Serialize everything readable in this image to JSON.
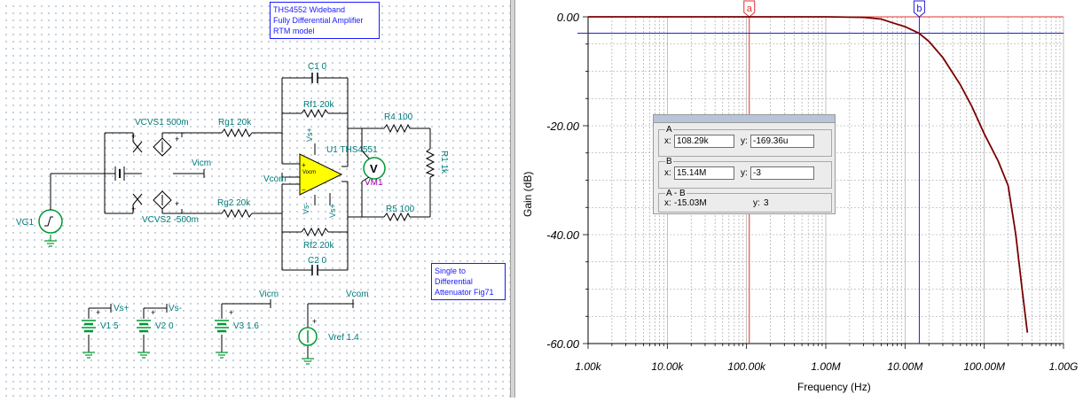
{
  "schematic": {
    "notes": {
      "title": [
        "THS4552 Wideband",
        "Fully Differential Amplifier",
        "RTM model"
      ],
      "config": [
        "Single to",
        "Differential",
        "Attenuator Fig71"
      ]
    },
    "labels": {
      "c1": "C1 0",
      "rf1": "Rf1 20k",
      "rg1": "Rg1 20k",
      "vcvs1": "VCVS1 500m",
      "r4": "R4 100",
      "u1": "U1 THS4551",
      "vicm_mid": "Vicm",
      "vcom_amp": "Vcom",
      "vm1": "VM1",
      "r1": "R1 1k",
      "rg2": "Rg2 20k",
      "vcvs2": "VCVS2 -500m",
      "r5": "R5 100",
      "vg1": "VG1",
      "rf2": "Rf2 20k",
      "c2": "C2 0",
      "vs_plus_top": "Vs+",
      "vs_minus_pin": "Vs-",
      "vs_plus_bottom": "Vs+",
      "vocm": "Vocm",
      "vs_plus_src": "Vs+",
      "vs_minus_src": "Vs-",
      "v1": "V1 5",
      "v2": "V2 0",
      "vicm_src": "Vicm",
      "v3": "V3 1.6",
      "vcom_src": "Vcom",
      "vref": "Vref 1.4",
      "meter_symbol": "V"
    }
  },
  "plot": {
    "ylabel": "Gain (dB)",
    "xlabel": "Frequency (Hz)",
    "y_ticks": [
      "0.00",
      "-20.00",
      "-40.00",
      "-60.00"
    ],
    "x_ticks": [
      "1.00k",
      "10.00k",
      "100.00k",
      "1.00M",
      "10.00M",
      "100.00M",
      "1.00G"
    ],
    "cursor_a_label": "a",
    "cursor_b_label": "b",
    "readout": {
      "a_title": "A",
      "a_x_label": "x:",
      "a_x": "108.29k",
      "a_y_label": "y:",
      "a_y": "-169.36u",
      "b_title": "B",
      "b_x_label": "x:",
      "b_x": "15.14M",
      "b_y_label": "y:",
      "b_y": "-3",
      "ab_title": "A - B",
      "ab_x_label": "x:",
      "ab_x": "-15.03M",
      "ab_y_label": "y:",
      "ab_y": "3"
    }
  },
  "chart_data": {
    "type": "line",
    "title": "",
    "xlabel": "Frequency (Hz)",
    "ylabel": "Gain (dB)",
    "x_scale": "log",
    "xlim": [
      1000,
      1000000000
    ],
    "ylim": [
      -60,
      0
    ],
    "grid": true,
    "x": [
      1000,
      10000,
      100000,
      1000000,
      3000000,
      5000000,
      7000000,
      10000000,
      15000000,
      20000000,
      30000000,
      50000000,
      70000000,
      100000000,
      150000000,
      200000000,
      250000000,
      300000000,
      350000000
    ],
    "series": [
      {
        "values": [
          0,
          0,
          0,
          0,
          -0.1,
          -0.4,
          -1.1,
          -1.8,
          -3,
          -4.5,
          -7.5,
          -12.5,
          -16.5,
          -21.5,
          -26.5,
          -31,
          -40,
          -50,
          -58
        ]
      }
    ],
    "cursors": {
      "a": {
        "x": 108290,
        "y": -0.00016936
      },
      "b": {
        "x": 15140000,
        "y": -3
      }
    },
    "colors": {
      "trace": "#7a0000",
      "cursor_a": "#e03030",
      "cursor_b": "#2020d0",
      "grid": "#9a9a9a"
    }
  }
}
